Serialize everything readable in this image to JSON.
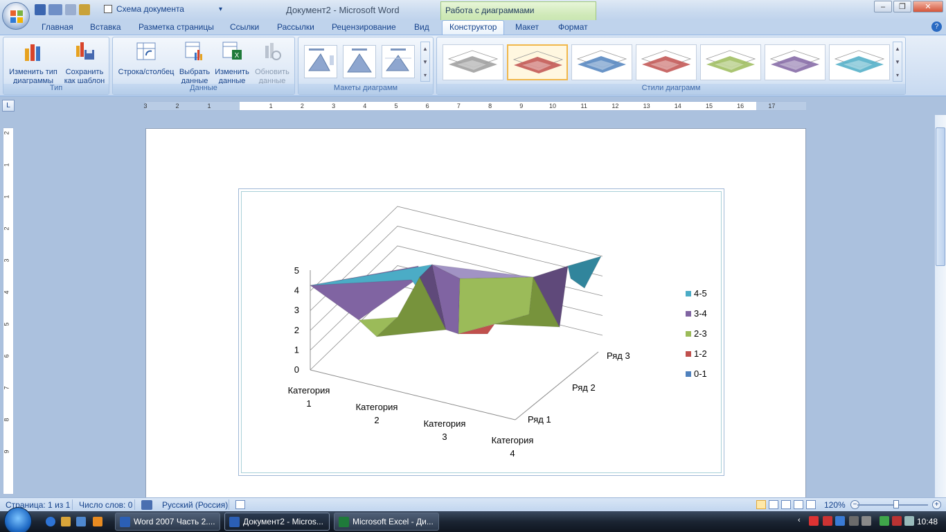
{
  "window": {
    "title": "Документ2 - Microsoft Word",
    "context_tab": "Работа с диаграммами",
    "schema_label": "Схема документа"
  },
  "tabs": [
    {
      "label": "Главная"
    },
    {
      "label": "Вставка"
    },
    {
      "label": "Разметка страницы"
    },
    {
      "label": "Ссылки"
    },
    {
      "label": "Рассылки"
    },
    {
      "label": "Рецензирование"
    },
    {
      "label": "Вид"
    },
    {
      "label": "Конструктор"
    },
    {
      "label": "Макет"
    },
    {
      "label": "Формат"
    }
  ],
  "ribbon": {
    "group_type": {
      "label": "Тип",
      "change_type_l1": "Изменить тип",
      "change_type_l2": "диаграммы",
      "save_tpl_l1": "Сохранить",
      "save_tpl_l2": "как шаблон"
    },
    "group_data": {
      "label": "Данные",
      "rowcol": "Строка/столбец",
      "select_l1": "Выбрать",
      "select_l2": "данные",
      "edit_l1": "Изменить",
      "edit_l2": "данные",
      "refresh_l1": "Обновить",
      "refresh_l2": "данные"
    },
    "group_layouts": {
      "label": "Макеты диаграмм"
    },
    "group_styles": {
      "label": "Стили диаграмм",
      "colors": [
        "#9b9b9b",
        "#c0504d",
        "#4f81bd",
        "#c0504d",
        "#9bbb59",
        "#8064a2",
        "#4bacc6"
      ]
    }
  },
  "ruler": {
    "h_numbers": [
      "3",
      "2",
      "1",
      "1",
      "2",
      "3",
      "4",
      "5",
      "6",
      "7",
      "8",
      "9",
      "10",
      "11",
      "12",
      "13",
      "14",
      "15",
      "16",
      "17"
    ],
    "v_numbers": [
      "2",
      "1",
      "1",
      "2",
      "3",
      "4",
      "5",
      "6",
      "7",
      "8",
      "9"
    ]
  },
  "chart_data": {
    "type": "surface-3d",
    "categories": [
      "Категория 1",
      "Категория 2",
      "Категория 3",
      "Категория 4"
    ],
    "series": [
      {
        "name": "Ряд 1"
      },
      {
        "name": "Ряд 2"
      },
      {
        "name": "Ряд 3"
      }
    ],
    "z_ticks": [
      "0",
      "1",
      "2",
      "3",
      "4",
      "5"
    ],
    "zlim": [
      0,
      5
    ],
    "legend_position": "right",
    "legend": [
      {
        "label": "4-5",
        "color": "#4bacc6"
      },
      {
        "label": "3-4",
        "color": "#8064a2"
      },
      {
        "label": "2-3",
        "color": "#9bbb59"
      },
      {
        "label": "1-2",
        "color": "#c0504d"
      },
      {
        "label": "0-1",
        "color": "#4f81bd"
      }
    ]
  },
  "status": {
    "page": "Страница: 1 из 1",
    "words": "Число слов: 0",
    "lang": "Русский (Россия)",
    "zoom": "120%"
  },
  "taskbar": {
    "items": [
      {
        "label": "Word 2007 Часть 2...."
      },
      {
        "label": "Документ2 - Micros..."
      },
      {
        "label": "Microsoft Excel - Ди..."
      }
    ],
    "clock": "10:48"
  }
}
